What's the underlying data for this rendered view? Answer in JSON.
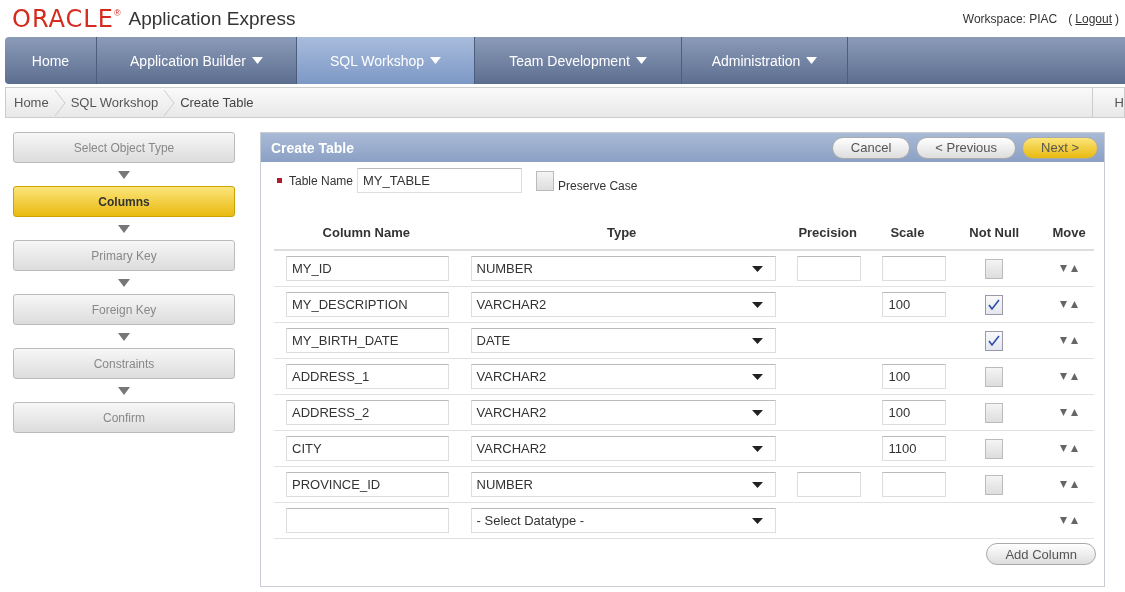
{
  "header": {
    "logo": "ORACLE",
    "logo_mark": "®",
    "product": "Application Express",
    "workspace": "Workspace: PIAC",
    "logout_open": "(",
    "logout": "Logout",
    "logout_close": ")"
  },
  "nav": [
    {
      "label": "Home",
      "menu": false,
      "selected": false
    },
    {
      "label": "Application Builder",
      "menu": true,
      "selected": false
    },
    {
      "label": "SQL Workshop",
      "menu": true,
      "selected": true
    },
    {
      "label": "Team Development",
      "menu": true,
      "selected": false
    },
    {
      "label": "Administration",
      "menu": true,
      "selected": false
    }
  ],
  "breadcrumb": {
    "items": [
      "Home",
      "SQL Workshop",
      "Create Table"
    ],
    "right": "H"
  },
  "steps": [
    {
      "label": "Select Object Type",
      "selected": false
    },
    {
      "label": "Columns",
      "selected": true
    },
    {
      "label": "Primary Key",
      "selected": false
    },
    {
      "label": "Foreign Key",
      "selected": false
    },
    {
      "label": "Constraints",
      "selected": false
    },
    {
      "label": "Confirm",
      "selected": false
    }
  ],
  "panel": {
    "title": "Create Table",
    "buttons": [
      {
        "label": "Cancel",
        "primary": false
      },
      {
        "label": "< Previous",
        "primary": false
      },
      {
        "label": "Next >",
        "primary": true
      }
    ],
    "table_name_label": "Table Name",
    "required": true,
    "table_name": "MY_TABLE",
    "preserve_case_label": "Preserve Case",
    "preserve_case": false,
    "columns": [
      "Column Name",
      "Type",
      "Precision",
      "Scale",
      "Not Null",
      "Move"
    ],
    "rows": [
      {
        "name": "MY_ID",
        "type": "NUMBER",
        "precision_field": true,
        "scale_field": true,
        "not_null_field": true,
        "not_null": false
      },
      {
        "name": "MY_DESCRIPTION",
        "type": "VARCHAR2",
        "precision_field": false,
        "scale_field": true,
        "scale": "100",
        "not_null_field": true,
        "not_null": true
      },
      {
        "name": "MY_BIRTH_DATE",
        "type": "DATE",
        "precision_field": false,
        "scale_field": false,
        "not_null_field": true,
        "not_null": true
      },
      {
        "name": "ADDRESS_1",
        "type": "VARCHAR2",
        "precision_field": false,
        "scale_field": true,
        "scale": "100",
        "not_null_field": true,
        "not_null": false
      },
      {
        "name": "ADDRESS_2",
        "type": "VARCHAR2",
        "precision_field": false,
        "scale_field": true,
        "scale": "100",
        "not_null_field": true,
        "not_null": false
      },
      {
        "name": "CITY",
        "type": "VARCHAR2",
        "precision_field": false,
        "scale_field": true,
        "scale": "1100",
        "not_null_field": true,
        "not_null": false
      },
      {
        "name": "PROVINCE_ID",
        "type": "NUMBER",
        "precision_field": true,
        "scale_field": true,
        "not_null_field": true,
        "not_null": false
      },
      {
        "type": "- Select Datatype -",
        "precision_field": false,
        "scale_field": false,
        "not_null_field": false
      }
    ],
    "add_button": "Add Column"
  }
}
